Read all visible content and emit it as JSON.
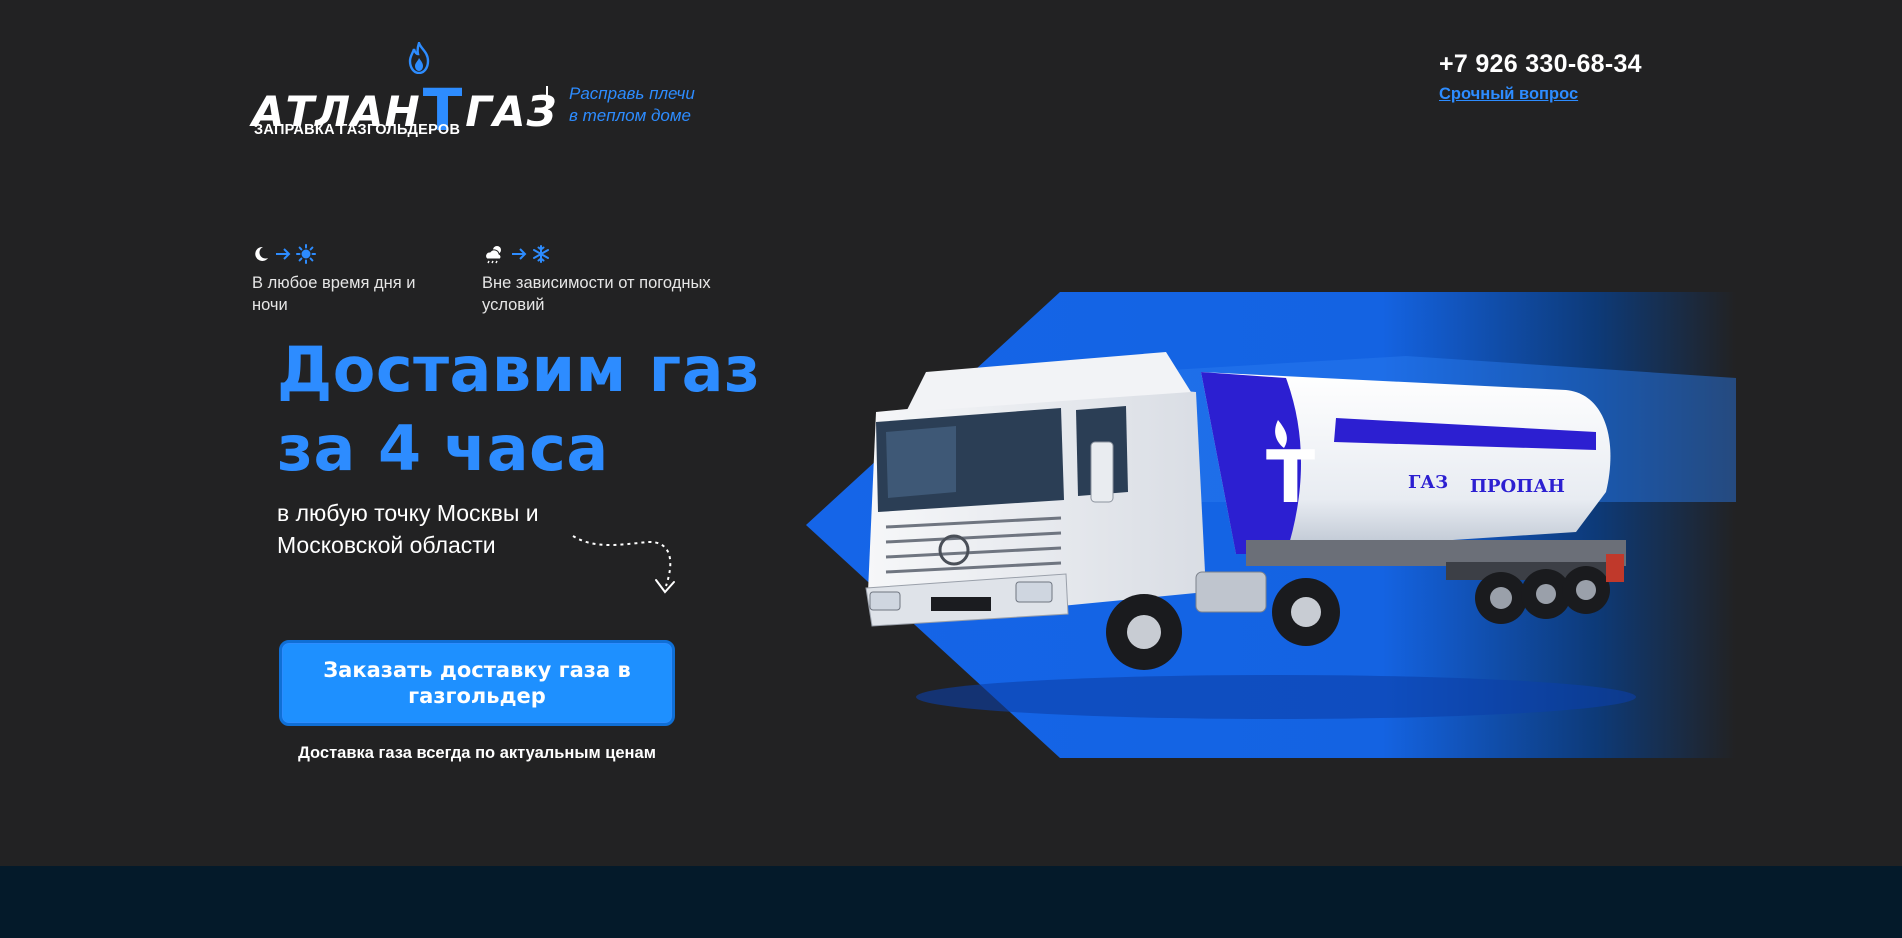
{
  "header": {
    "logo_left": "АТЛАН",
    "logo_t": "Т",
    "logo_right": "ГАЗ",
    "logo_sub": "ЗАПРАВКА ГАЗГОЛЬДЕРОВ",
    "slogan_line1": "Расправь плечи",
    "slogan_line2": "в теплом доме",
    "phone": "+7 926 330-68-34",
    "urgent_link": "Срочный вопрос"
  },
  "features": [
    {
      "icons": [
        "moon-icon",
        "arrow-right-icon",
        "sun-icon"
      ],
      "text_line1": "В любое время дня и",
      "text_line2": "ночи"
    },
    {
      "icons": [
        "cloud-sun-icon",
        "arrow-right-icon",
        "snowflake-icon"
      ],
      "text_line1": "Вне зависимости от погодных",
      "text_line2": "условий"
    }
  ],
  "hero": {
    "headline_line1": "Доставим газ",
    "headline_line2": "за 4 часа",
    "sub_line1": "в любую точку Москвы и",
    "sub_line2": "Московской области",
    "cta_label": "Заказать доставку газа в газгольдер",
    "price_note": "Доставка газа всегда по актуальным ценам",
    "truck_label_1": "ГАЗ",
    "truck_label_2": "ПРОПАН",
    "truck_letter": "T"
  },
  "colors": {
    "background": "#222223",
    "accent": "#2d8cff",
    "bottom_band": "#041a2a"
  }
}
